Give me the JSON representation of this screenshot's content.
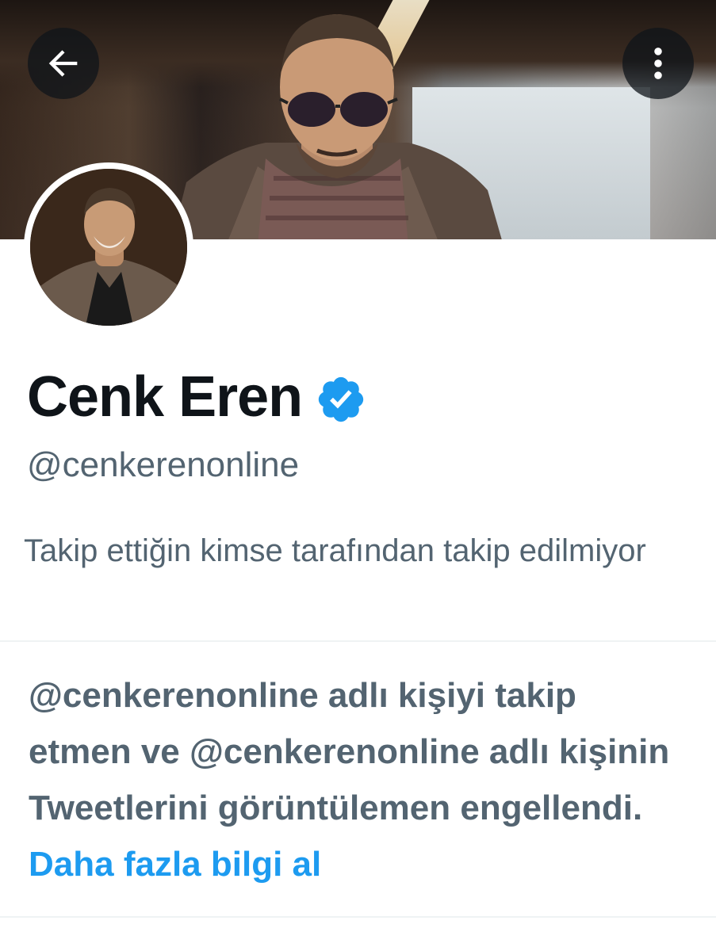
{
  "header": {
    "back_icon": "arrow-left-icon",
    "more_icon": "more-vertical-icon"
  },
  "profile": {
    "display_name": "Cenk Eren",
    "verified_icon": "verified-badge-icon",
    "verified_color": "#1d9bf0",
    "handle": "@cenkerenonline",
    "followers_you_know": "Takip ettiğin kimse tarafından takip edilmiyor"
  },
  "blocked_notice": {
    "message": "@cenkerenonline adlı kişiyi takip etmen ve @cenkerenonline adlı kişinin Tweetlerini görüntülemen engellendi.",
    "learn_more": "Daha fazla bilgi al",
    "link_color": "#1d9bf0"
  }
}
